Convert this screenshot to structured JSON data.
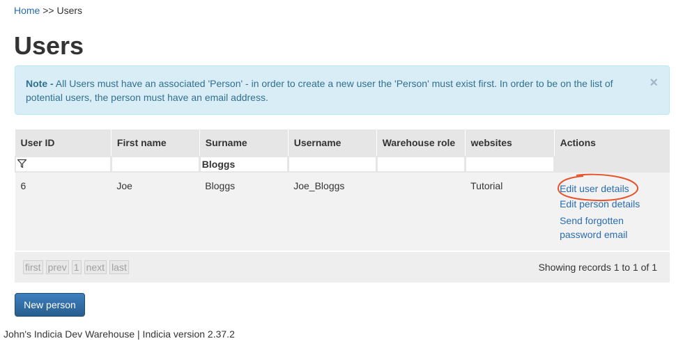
{
  "breadcrumb": {
    "home": "Home",
    "separator": ">>",
    "current": "Users"
  },
  "page": {
    "title": "Users"
  },
  "alert": {
    "label": "Note -",
    "message": "All Users must have an associated 'Person' - in order to create a new user the 'Person' must exist first. In order to be on the list of potential users, the person must have an email address.",
    "close": "×"
  },
  "table": {
    "columns": [
      "User ID",
      "First name",
      "Surname",
      "Username",
      "Warehouse role",
      "websites",
      "Actions"
    ],
    "filters": {
      "user_id": "",
      "first_name": "",
      "surname": "Bloggs",
      "username": "",
      "warehouse_role": "",
      "websites": ""
    },
    "rows": [
      {
        "user_id": "6",
        "first_name": "Joe",
        "surname": "Bloggs",
        "username": "Joe_Bloggs",
        "warehouse_role": "",
        "websites": "Tutorial",
        "actions": [
          "Edit user details",
          "Edit person details",
          "Send forgotten password email"
        ]
      }
    ]
  },
  "pager": {
    "first": "first",
    "prev": "prev",
    "page": "1",
    "next": "next",
    "last": "last"
  },
  "record_count": "Showing records 1 to 1 of 1",
  "buttons": {
    "new_person": "New person"
  },
  "footer": "John's Indicia Dev Warehouse | Indicia version 2.37.2",
  "colors": {
    "link": "#2a6cb0",
    "alert_bg": "#d9edf7",
    "alert_text": "#31708f",
    "primary": "#2e6da4",
    "annotation": "#e8522b"
  },
  "icons": {
    "filter": "filter-icon",
    "close": "close-icon"
  }
}
